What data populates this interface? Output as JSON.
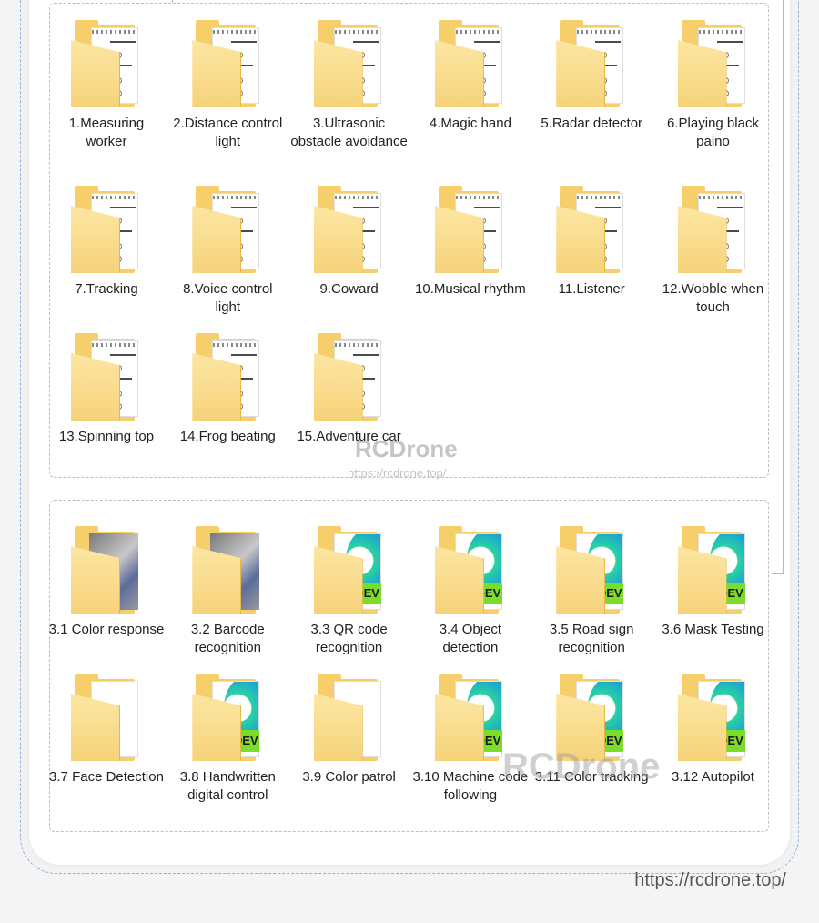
{
  "section_1": {
    "items": [
      {
        "label": "1.Measuring worker",
        "icon": "notebook-folder-icon"
      },
      {
        "label": "2.Distance control light",
        "icon": "notebook-folder-icon"
      },
      {
        "label": "3.Ultrasonic obstacle avoidance",
        "icon": "notebook-folder-icon"
      },
      {
        "label": "4.Magic hand",
        "icon": "notebook-folder-icon"
      },
      {
        "label": "5.Radar detector",
        "icon": "notebook-folder-icon"
      },
      {
        "label": "6.Playing black paino",
        "icon": "notebook-folder-icon"
      },
      {
        "label": "7.Tracking",
        "icon": "notebook-folder-icon"
      },
      {
        "label": "8.Voice control light",
        "icon": "notebook-folder-icon"
      },
      {
        "label": "9.Coward",
        "icon": "notebook-folder-icon"
      },
      {
        "label": "10.Musical rhythm",
        "icon": "notebook-folder-icon"
      },
      {
        "label": "11.Listener",
        "icon": "notebook-folder-icon"
      },
      {
        "label": "12.Wobble when touch",
        "icon": "notebook-folder-icon"
      },
      {
        "label": "13.Spinning top",
        "icon": "notebook-folder-icon"
      },
      {
        "label": "14.Frog beating",
        "icon": "notebook-folder-icon"
      },
      {
        "label": "15.Adventure car",
        "icon": "notebook-folder-icon"
      }
    ]
  },
  "section_2": {
    "items": [
      {
        "label": "3.1 Color response",
        "icon": "photo-folder-icon"
      },
      {
        "label": "3.2 Barcode recognition",
        "icon": "photo-folder-icon"
      },
      {
        "label": "3.3 QR code recognition",
        "icon": "dev-folder-icon"
      },
      {
        "label": "3.4 Object detection",
        "icon": "dev-folder-icon"
      },
      {
        "label": "3.5 Road sign recognition",
        "icon": "dev-folder-icon"
      },
      {
        "label": "3.6 Mask Testing",
        "icon": "dev-folder-icon"
      },
      {
        "label": "3.7 Face Detection",
        "icon": "plain-folder-icon"
      },
      {
        "label": "3.8 Handwritten digital control",
        "icon": "dev-folder-icon"
      },
      {
        "label": "3.9 Color patrol",
        "icon": "plain-folder-icon"
      },
      {
        "label": "3.10 Machine code following",
        "icon": "dev-folder-icon"
      },
      {
        "label": "3.11 Color tracking",
        "icon": "dev-folder-icon"
      },
      {
        "label": "3.12 Autopilot",
        "icon": "dev-folder-icon"
      }
    ]
  },
  "watermark": {
    "brand": "RCDrone",
    "url": "https://rcdrone.top/"
  },
  "footer": {
    "url": "https://rcdrone.top/"
  },
  "dev_badge_text": "DEV",
  "colors": {
    "folder": "#f6cf6b",
    "dev_badge": "#7bdc2a",
    "frame_dash": "#8fb4d8"
  }
}
